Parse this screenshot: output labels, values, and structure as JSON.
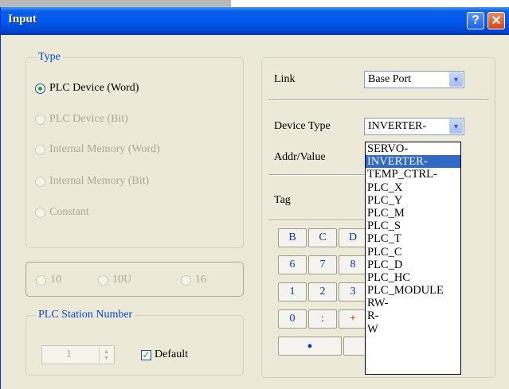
{
  "window": {
    "title": "Input",
    "help_glyph": "?",
    "close_glyph": "✕"
  },
  "type_group": {
    "legend": "Type",
    "options": [
      {
        "label": "PLC Device (Word)",
        "selected": true,
        "enabled": true
      },
      {
        "label": "PLC Device (Bit)",
        "selected": false,
        "enabled": false
      },
      {
        "label": "Internal Memory (Word)",
        "selected": false,
        "enabled": false
      },
      {
        "label": "Internal Memory (Bit)",
        "selected": false,
        "enabled": false
      },
      {
        "label": "Constant",
        "selected": false,
        "enabled": false
      }
    ]
  },
  "radix_group": {
    "options": [
      "10",
      "10U",
      "16"
    ]
  },
  "station_group": {
    "legend": "PLC Station Number",
    "number_value": "1",
    "default_label": "Default",
    "default_checked": true
  },
  "right_panel": {
    "link_label": "Link",
    "link_value": "Base Port",
    "device_type_label": "Device Type",
    "device_type_value": "INVERTER-",
    "addr_label": "Addr/Value",
    "tag_label": "Tag"
  },
  "keypad": {
    "row1": [
      "B",
      "C",
      "D"
    ],
    "row2": [
      "6",
      "7",
      "8"
    ],
    "row3": [
      "1",
      "2",
      "3"
    ],
    "row4": [
      "0",
      ":",
      "+"
    ],
    "row5": [
      "●"
    ]
  },
  "device_type_list": {
    "items": [
      "SERVO-",
      "INVERTER-",
      "TEMP_CTRL-",
      "PLC_X",
      "PLC_Y",
      "PLC_M",
      "PLC_S",
      "PLC_T",
      "PLC_C",
      "PLC_D",
      "PLC_HC",
      "PLC_MODULE",
      "RW-",
      "R-",
      "W"
    ],
    "selected": "INVERTER-"
  },
  "colors": {
    "title_bar": "#0058ee",
    "legend_text": "#0046d5",
    "selection": "#316ac5",
    "keypad_text": "#0033cc",
    "dialog_bg": "#ece9d8"
  }
}
